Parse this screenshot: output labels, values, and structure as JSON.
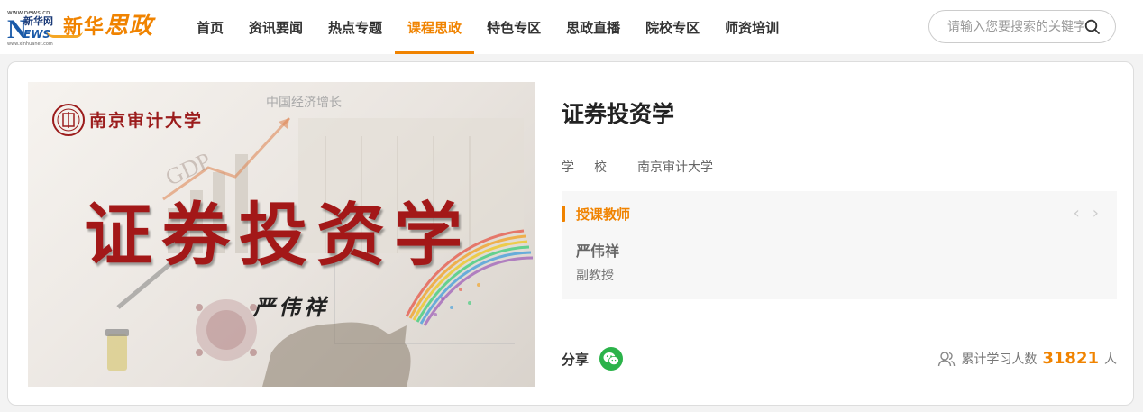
{
  "logo": {
    "url_text": "www.news.cn",
    "n_letter": "N",
    "xhw": "新华网",
    "ews": "EWS",
    "sub": "www.xinhuanet.com",
    "brand_a": "新华",
    "brand_b": "思政"
  },
  "nav": {
    "items": [
      {
        "label": "首页"
      },
      {
        "label": "资讯要闻"
      },
      {
        "label": "热点专题"
      },
      {
        "label": "课程思政"
      },
      {
        "label": "特色专区"
      },
      {
        "label": "思政直播"
      },
      {
        "label": "院校专区"
      },
      {
        "label": "师资培训"
      }
    ],
    "active_index": 3
  },
  "search": {
    "placeholder": "请输入您要搜索的关键字"
  },
  "cover": {
    "university": "南京审计大学",
    "econ_label": "中国经济增长",
    "gdp_label": "GDP",
    "title": "证券投资学",
    "teacher": "严伟祥"
  },
  "course": {
    "title": "证券投资学",
    "school_label": "学校",
    "school_value": "南京审计大学",
    "teacher_heading": "授课教师",
    "teacher_name": "严伟祥",
    "teacher_rank": "副教授",
    "share_label": "分享",
    "stats_label": "累计学习人数",
    "stats_count": "31821",
    "stats_unit": "人"
  },
  "colors": {
    "accent": "#f08300",
    "wechat": "#2bb34a",
    "cover_title": "#a31818"
  },
  "icons": {
    "search": "search-icon",
    "prev": "chevron-left-icon",
    "next": "chevron-right-icon",
    "wechat": "wechat-icon",
    "users": "users-icon"
  }
}
